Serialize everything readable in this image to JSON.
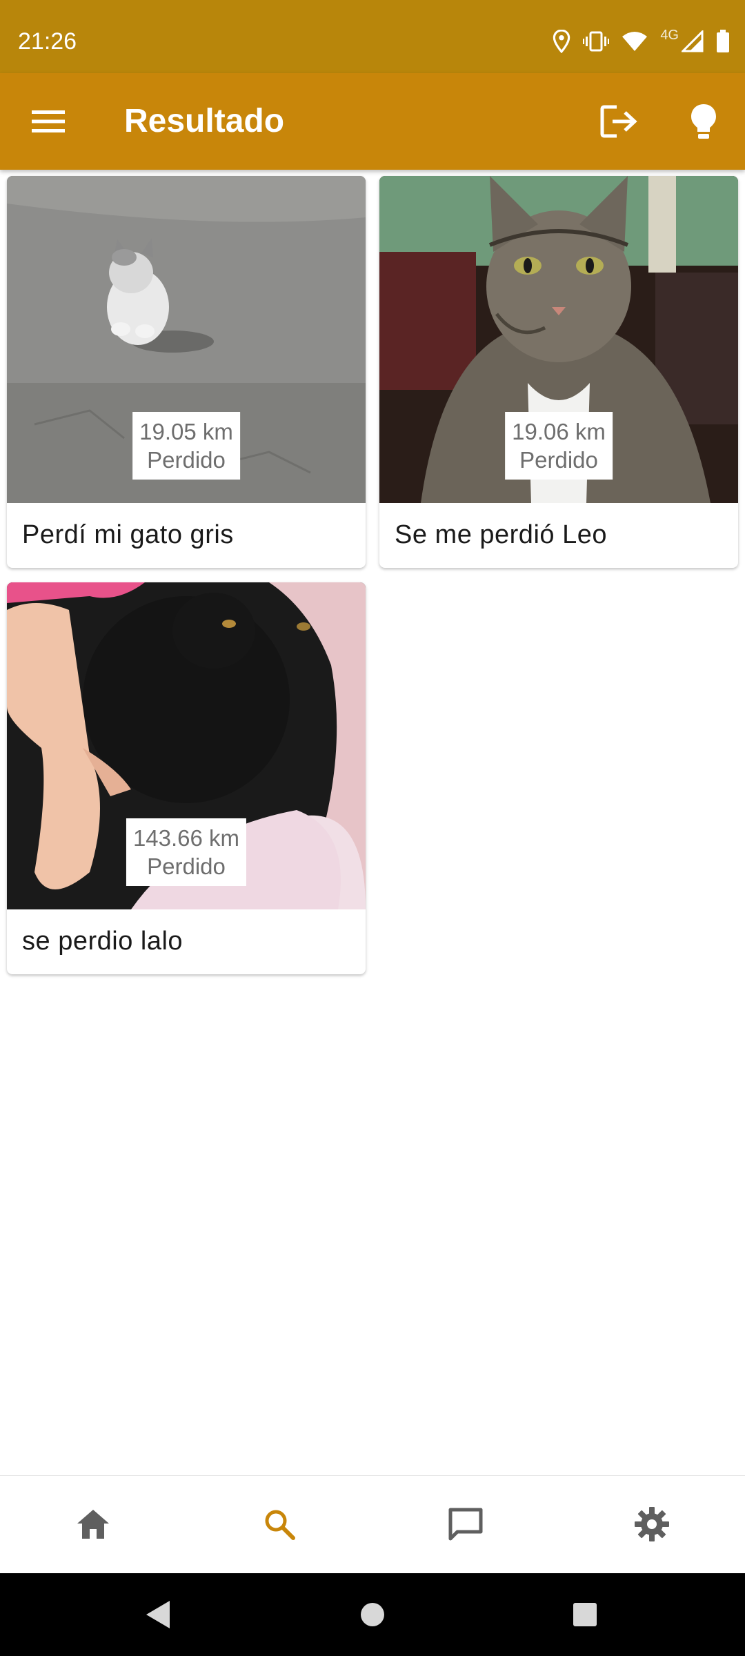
{
  "status_bar": {
    "time": "21:26",
    "network_label": "4G",
    "icons": [
      "location-icon",
      "vibrate-icon",
      "wifi-icon",
      "signal-icon",
      "battery-icon"
    ]
  },
  "app_bar": {
    "title": "Resultado",
    "menu_icon": "hamburger-menu-icon",
    "actions": [
      "logout-icon",
      "lightbulb-icon"
    ],
    "background_color": "#C8860A"
  },
  "results": [
    {
      "distance": "19.05 km",
      "status": "Perdido",
      "title": "Perdí mi gato gris",
      "image": "gray-white-cat-photo"
    },
    {
      "distance": "19.06 km",
      "status": "Perdido",
      "title": "Se me perdió Leo",
      "image": "tabby-cat-photo"
    },
    {
      "distance": "143.66 km",
      "status": "Perdido",
      "title": "se perdio lalo",
      "image": "black-cat-photo"
    }
  ],
  "bottom_nav": {
    "items": [
      "home-icon",
      "search-icon",
      "chat-icon",
      "settings-icon"
    ],
    "active": "search-icon",
    "active_color": "#C8860A",
    "inactive_color": "#5f5f5f"
  },
  "system_nav": [
    "back-icon",
    "home-circle-icon",
    "recents-icon"
  ]
}
